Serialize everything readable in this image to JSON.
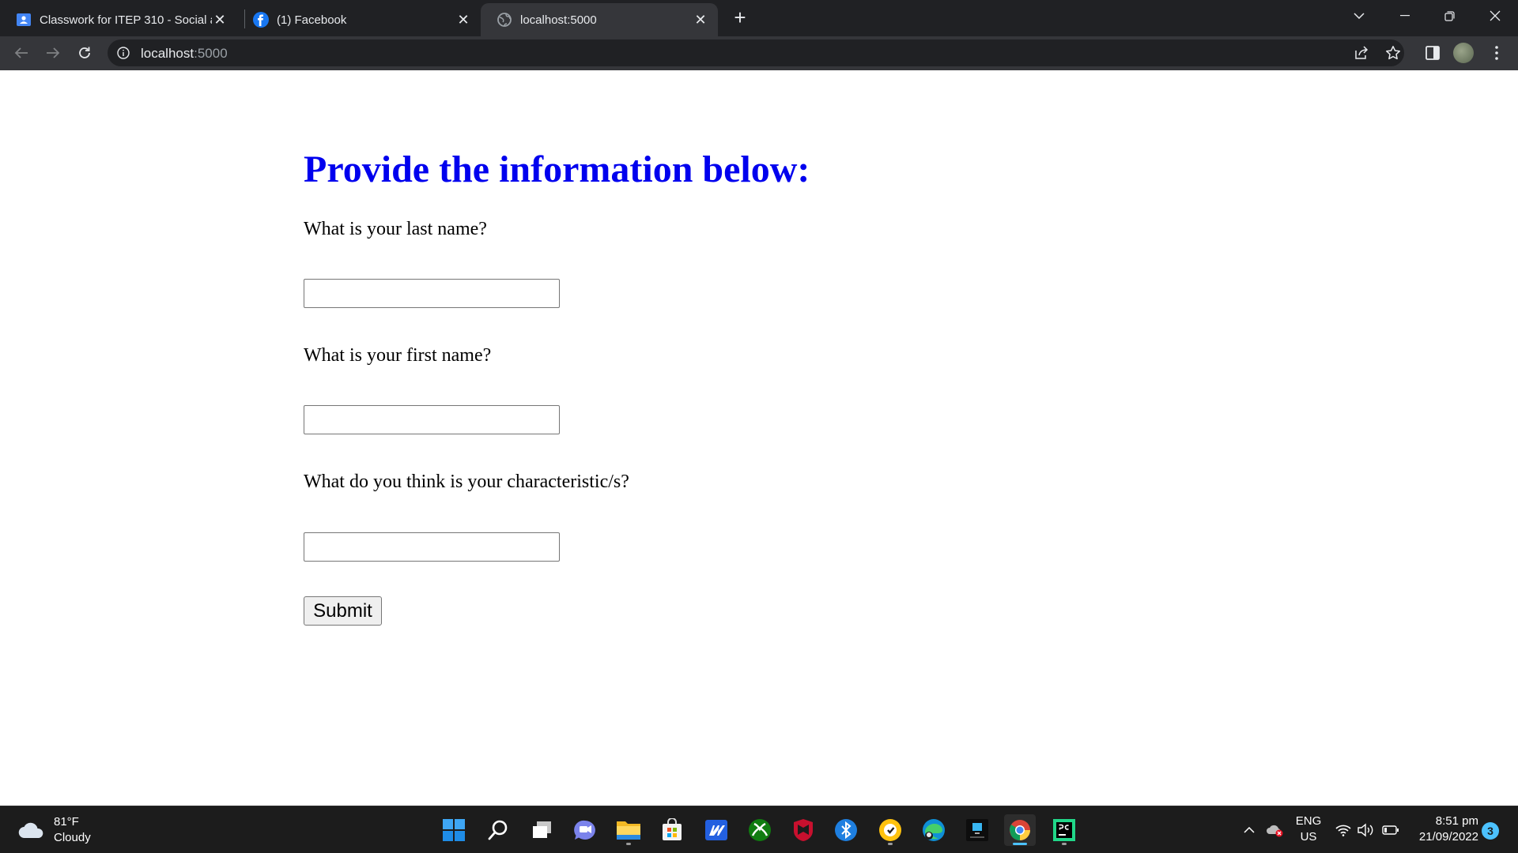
{
  "browser": {
    "tabs": [
      {
        "title": "Classwork for ITEP 310 - Social ar",
        "icon": "classroom-icon",
        "active": false
      },
      {
        "title": "(1) Facebook",
        "icon": "facebook-icon",
        "active": false
      },
      {
        "title": "localhost:5000",
        "icon": "globe-icon",
        "active": true
      }
    ],
    "new_tab_label": "+",
    "address": {
      "host": "localhost",
      "port": ":5000"
    }
  },
  "form": {
    "heading": "Provide the information below:",
    "heading_color": "#0000ee",
    "questions": [
      {
        "label": "What is your last name?",
        "value": ""
      },
      {
        "label": "What is your first name?",
        "value": ""
      },
      {
        "label": "What do you think is your characteristic/s?",
        "value": ""
      }
    ],
    "submit_label": "Submit"
  },
  "taskbar": {
    "weather": {
      "temp": "81°F",
      "condition": "Cloudy"
    },
    "apps": [
      "start-icon",
      "search-icon",
      "task-view-icon",
      "teams-chat-icon",
      "file-explorer-icon",
      "microsoft-store-icon",
      "app-m-icon",
      "xbox-icon",
      "mcafee-icon",
      "bluetooth-app-icon",
      "norton-icon",
      "edge-icon",
      "obs-icon",
      "chrome-icon",
      "pycharm-icon"
    ],
    "language": {
      "line1": "ENG",
      "line2": "US"
    },
    "clock": {
      "time": "8:51 pm",
      "date": "21/09/2022"
    },
    "notifications": "3",
    "accent": "#4cc2ff"
  }
}
